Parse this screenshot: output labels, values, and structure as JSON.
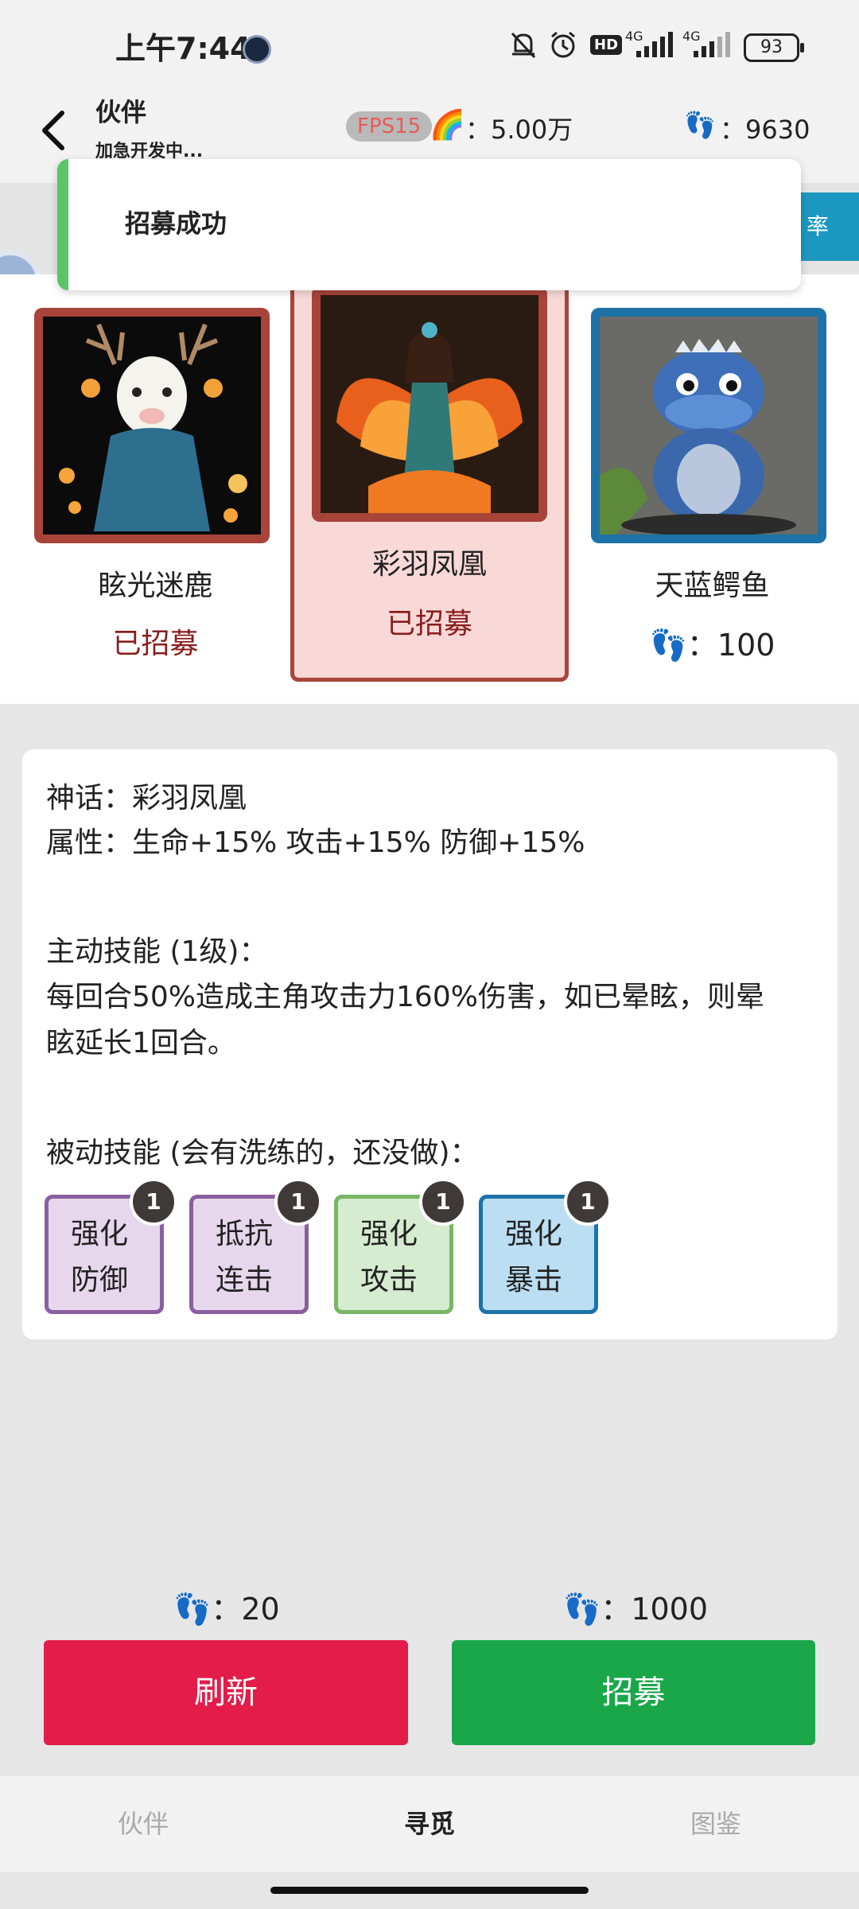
{
  "status_bar": {
    "time": "上午7:44",
    "network_1": "4G",
    "network_2": "4G",
    "hd": "HD",
    "battery": "93",
    "icons": [
      "bell-off-icon",
      "alarm-icon",
      "hd-icon",
      "signal-icon",
      "signal-icon",
      "battery-icon"
    ]
  },
  "header": {
    "title": "伙伴",
    "subtitle": "加急开发中...",
    "fps_badge": "FPS15",
    "currency_value": "：5.00万",
    "steps_value": "：9630"
  },
  "toolbar": {
    "rate_button_label": "率"
  },
  "toast": {
    "message": "招募成功"
  },
  "cards": [
    {
      "name": "眩光迷鹿",
      "status": "已招募",
      "selected": false,
      "theme": "dark-deer"
    },
    {
      "name": "彩羽凤凰",
      "status": "已招募",
      "selected": true,
      "theme": "phoenix"
    },
    {
      "name": "天蓝鳄鱼",
      "cost": "：100",
      "selected": false,
      "theme": "blue-crocodile"
    }
  ],
  "detail": {
    "line_myth": "神话：彩羽凤凰",
    "line_attr": "属性：生命+15% 攻击+15% 防御+15%",
    "active_skill_title": "主动技能 (1级)：",
    "active_skill_desc_1": "每回合50%造成主角攻击力160%伤害，如已晕眩，则晕",
    "active_skill_desc_2": "眩延长1回合。",
    "passive_skill_title": "被动技能 (会有洗练的，还没做)：",
    "passive_skills": [
      {
        "line1": "强化",
        "line2": "防御",
        "level": "1",
        "color": "#e6d7ec",
        "border": "#8a5fa0"
      },
      {
        "line1": "抵抗",
        "line2": "连击",
        "level": "1",
        "color": "#e6d7ec",
        "border": "#8a5fa0"
      },
      {
        "line1": "强化",
        "line2": "攻击",
        "level": "1",
        "color": "#d6ecd0",
        "border": "#79b564"
      },
      {
        "line1": "强化",
        "line2": "暴击",
        "level": "1",
        "color": "#bcdef3",
        "border": "#1d72a8"
      }
    ]
  },
  "actions": {
    "refresh_cost": "：20",
    "recruit_cost": "：1000",
    "refresh_label": "刷新",
    "recruit_label": "招募"
  },
  "tabs": [
    {
      "label": "伙伴",
      "active": false
    },
    {
      "label": "寻觅",
      "active": true
    },
    {
      "label": "图鉴",
      "active": false
    }
  ]
}
